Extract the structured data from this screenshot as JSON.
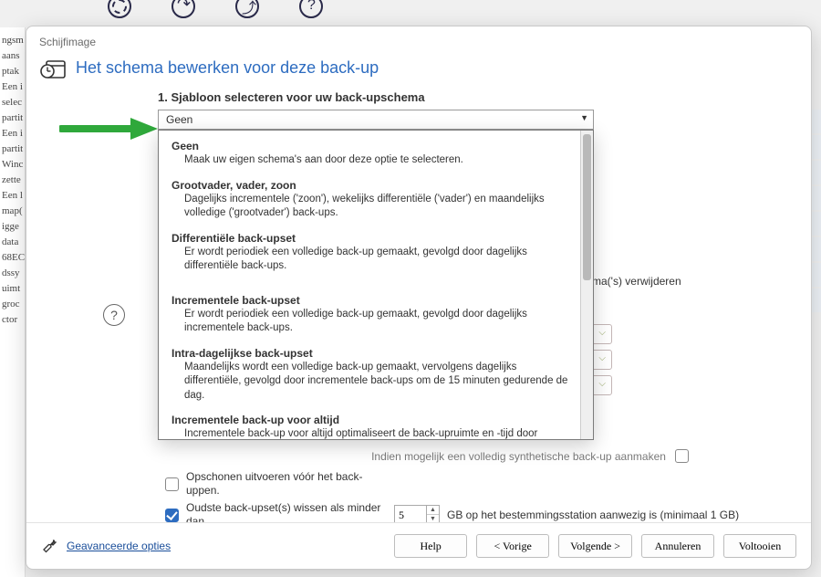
{
  "bg": {
    "sidebar_text": "ngsm\naans\nptak\nEen i\nselec\npartit\nEen i\npartit\nWinc\nzette\nEen l\nmap(\nigge\ndata\n68EC\ndssy\nuimt\ngroc\nctor"
  },
  "dialog": {
    "window_title": "Schijfimage",
    "header": "Het schema bewerken voor deze back-up",
    "section1_title": "1. Sjabloon selecteren voor uw back-upschema",
    "combo_value": "Geen",
    "options": [
      {
        "title": "Geen",
        "desc": "Maak uw eigen schema's aan door deze optie te selecteren."
      },
      {
        "title": "Grootvader, vader, zoon",
        "desc": "Dagelijks incrementele ('zoon'), wekelijks differentiële ('vader') en maandelijks volledige ('grootvader') back-ups."
      },
      {
        "title": "Differentiële back-upset",
        "desc": "Er wordt periodiek een volledige back-up gemaakt, gevolgd door dagelijks differentiële back-ups."
      },
      {
        "title": "Incrementele back-upset",
        "desc": "Er wordt periodiek een volledige back-up gemaakt, gevolgd door dagelijks incrementele back-ups."
      },
      {
        "title": "Intra-dagelijkse back-upset",
        "desc": "Maandelijks wordt een volledige back-up gemaakt, vervolgens dagelijks differentiële, gevolgd door incrementele back-ups om de 15 minuten gedurende de dag."
      },
      {
        "title": "Incrementele back-up voor altijd",
        "desc": "Incrementele back-up voor altijd optimaliseert de back-upruimte en -tijd door slechts één volledige back-up te maken."
      }
    ],
    "rhs_fragment": "ma('s) verwijderen",
    "synthetic_label": "Indien mogelijk een volledig synthetische back-up aanmaken",
    "cleanup_before_label": "Opschonen uitvoeren vóór het back-uppen.",
    "oldest_delete_label": "Oudste back-upset(s) wissen als minder dan",
    "gb_value": "5",
    "gb_tail": "GB op het bestemmingsstation aanwezig is (minimaal 1 GB)",
    "advanced_label": "Geavanceerde opties",
    "buttons": {
      "help": "Help",
      "prev": "< Vorige",
      "next": "Volgende >",
      "cancel": "Annuleren",
      "finish": "Voltooien"
    }
  }
}
